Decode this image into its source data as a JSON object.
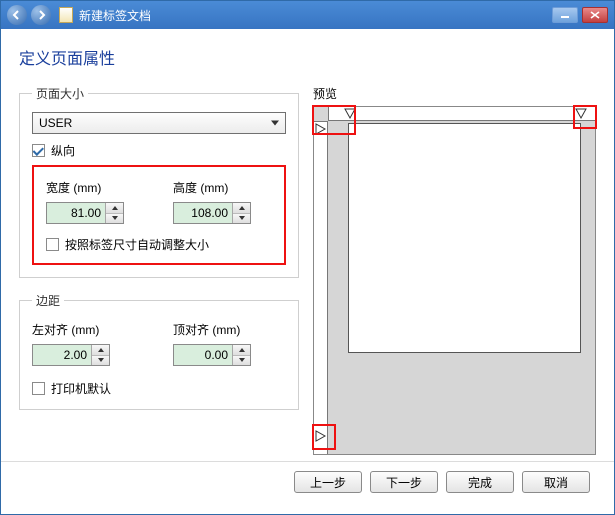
{
  "titlebar": {
    "title": "新建标签文档"
  },
  "page_title": "定义页面属性",
  "page_size": {
    "legend": "页面大小",
    "preset": "USER",
    "portrait_label": "纵向",
    "portrait_checked": true,
    "width_label": "宽度 (mm)",
    "width_value": "81.00",
    "height_label": "高度 (mm)",
    "height_value": "108.00",
    "auto_adjust_label": "按照标签尺寸自动调整大小",
    "auto_adjust_checked": false
  },
  "margins": {
    "legend": "边距",
    "left_label": "左对齐 (mm)",
    "left_value": "2.00",
    "top_label": "顶对齐 (mm)",
    "top_value": "0.00",
    "printer_default_label": "打印机默认",
    "printer_default_checked": false
  },
  "preview": {
    "label": "预览"
  },
  "buttons": {
    "prev": "上一步",
    "next": "下一步",
    "finish": "完成",
    "cancel": "取消"
  }
}
